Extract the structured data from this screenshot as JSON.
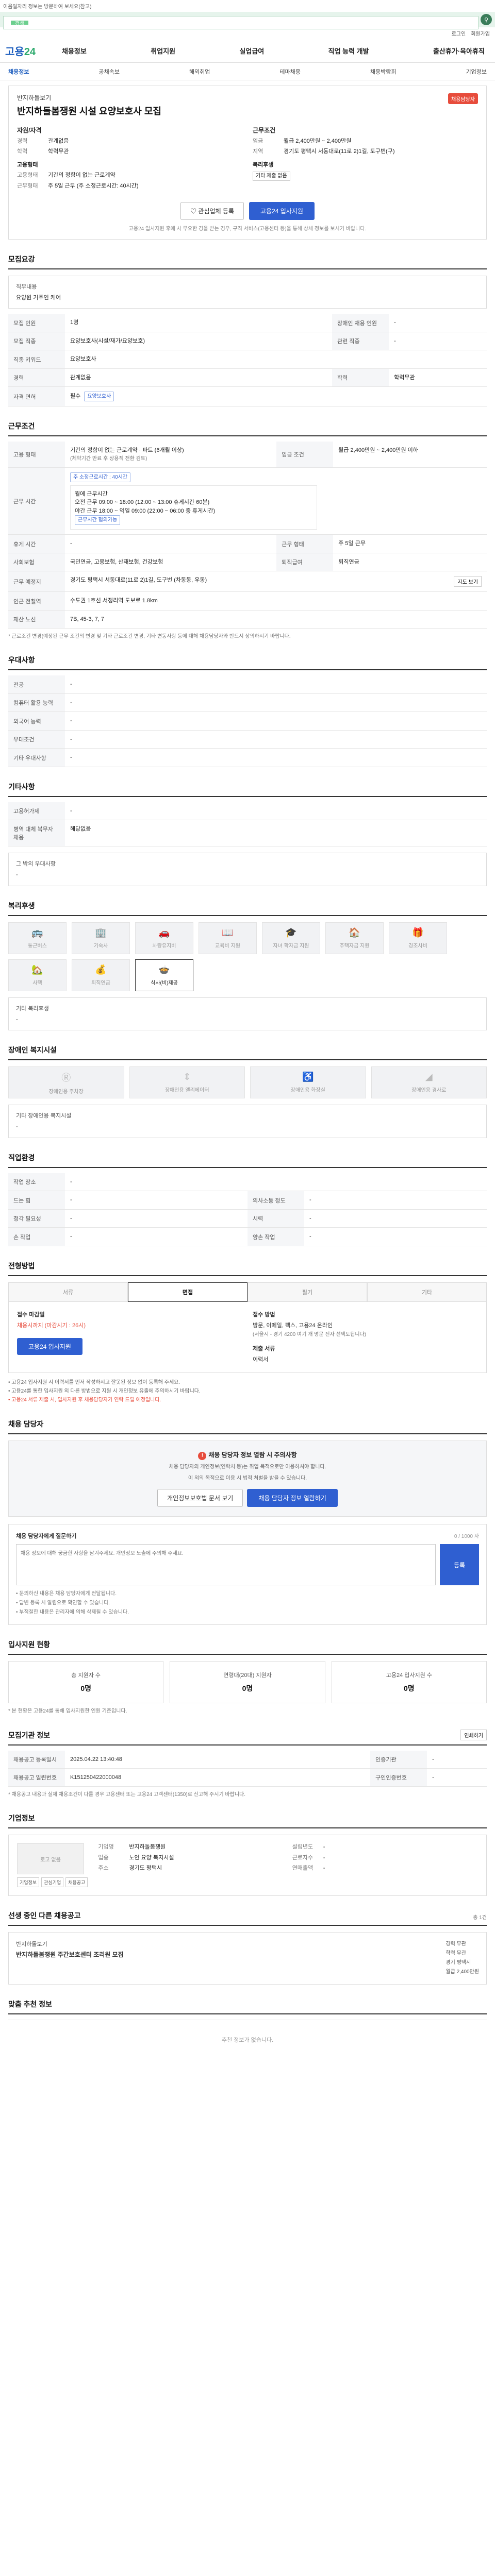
{
  "top_notice": "이음일자리 정보는 방문하여 보세요(참고)",
  "search": {
    "label": "검색",
    "placeholder": ""
  },
  "util_links": [
    "로그인",
    "회원가입"
  ],
  "logo": {
    "main": "고용",
    "accent": "24"
  },
  "gnb": [
    "채용정보",
    "취업지원",
    "실업급여",
    "직업 능력 개발",
    "출산휴가·육아휴직"
  ],
  "subnav": [
    {
      "label": "채용정보",
      "active": true
    },
    {
      "label": "공채속보",
      "active": false
    },
    {
      "label": "해외취업",
      "active": false
    },
    {
      "label": "테마채용",
      "active": false
    },
    {
      "label": "채용박람회",
      "active": false
    },
    {
      "label": "기업정보",
      "active": false
    }
  ],
  "job": {
    "company": "반지하돌보기",
    "title": "반지하돌봄쟁원 시설 요양보호사 모집",
    "badge": "채용담당자",
    "left_title": "자원/자격",
    "left": [
      {
        "k": "경력",
        "v": "관계없음"
      },
      {
        "k": "학력",
        "v": "학력무관"
      },
      {
        "k": "고용형태",
        "v": ""
      },
      {
        "k": "고용형태",
        "v": "기간의 정함이 없는 근로계약"
      },
      {
        "k": "근무형태",
        "v": "주 5일 근무 (주 소정근로시간: 40시간)"
      }
    ],
    "right_title": "근무조건",
    "right": [
      {
        "k": "임금",
        "v": "월급 2,400만원 ~ 2,400만원"
      },
      {
        "k": "지역",
        "v": "경기도 평택시 서동대로(11로 2)1길, 도구번(구)"
      },
      {
        "k": "복리후생",
        "v": ""
      },
      {
        "k": "",
        "v": "기타 제출 없음"
      }
    ],
    "btn_interest": "관심업체 등록",
    "btn_apply": "고용24 입사지원",
    "notice": "고용24 입사지원 후에 사 무요한 경을 받는 경우, 구직 서비스(고용센터 등)을 통해 상세 정보를 보시기 바랍니다."
  },
  "recruit_summary": {
    "title": "모집요강",
    "duty_label": "직무내용",
    "duty": "요양원 거주인 케어",
    "rows": [
      {
        "k": "모집 인원",
        "v": "1명",
        "k2": "장애인 채용 인원",
        "v2": "-"
      },
      {
        "k": "모집 직종",
        "v": "요양보호사(시설/재가/요양보호)",
        "k2": "관련 직종",
        "v2": "-"
      },
      {
        "k": "직종 키워드",
        "v": "요양보호사",
        "k2": "",
        "v2": ""
      },
      {
        "k": "경력",
        "v": "관계없음",
        "k2": "학력",
        "v2": "학력무관"
      },
      {
        "k": "자격 면허",
        "v": "필수",
        "k2": "",
        "v2": ""
      }
    ],
    "license": "요양보호사"
  },
  "conditions": {
    "title": "근무조건",
    "employment": "기간의 정함이 없는 근로계약 · 파트 (6개월 이상)",
    "employment_sub": "(체약기간 만료 후 상용직 전환 검토)",
    "wage_label": "임금 조건",
    "wage": "월급 2,400만원 ~ 2,400만원 이하",
    "hours_label": "근무 시간",
    "hours_tag": "주 소정근로시간 : 40시간",
    "hours": [
      "월에 근무시간",
      "오전 근무 09:00 ~ 18:00 (12:00 ~ 13:00 휴게시간 60분)",
      "야간 근무 18:00 ~ 익일 09:00 (22:00 ~ 06:00 중 휴게시간)",
      "근무시간 협의가능"
    ],
    "holiday_label": "휴게 시간",
    "holiday": "-",
    "shift_label": "근무 형태",
    "shift": "주 5일 근무",
    "insurance_label": "사회보험",
    "insurance": "국민연금, 고용보험, 산재보험, 건강보험",
    "retire_label": "퇴직급여",
    "retire": "퇴직연금",
    "place_label": "근무 예정지",
    "place": "경기도 평택시 서동대로(11로 2)1길, 도구번 (차동동, 우동)",
    "map_btn": "지도 보기",
    "station_label": "인근 전철역",
    "station": "수도권 1호선 서정리역 도보로 1.8km",
    "industry_label": "재산 노선",
    "industry": "7B, 45-3, 7, 7",
    "note": "* 근로조건 변경(예정된 근무 조건의 변경 및 기타 근로조건 변경, 기타 변동사항 등에 대해 채용담당자와 반드시 상의하시기 바랍니다."
  },
  "preferred": {
    "title": "우대사항",
    "rows": [
      {
        "k": "전공",
        "v": "-"
      },
      {
        "k": "컴퓨터 활용 능력",
        "v": "-"
      },
      {
        "k": "외국어 능력",
        "v": "-"
      },
      {
        "k": "우대조건",
        "v": "-"
      },
      {
        "k": "기타 우대사항",
        "v": "-"
      }
    ]
  },
  "other": {
    "title": "기타사항",
    "rows": [
      {
        "k": "고용허가제",
        "v": "-"
      },
      {
        "k": "병역 대체 복무자 채용",
        "v": "해당없음"
      }
    ],
    "extra_title": "그 밖의 우대사항",
    "extra": "-"
  },
  "welfare": {
    "title": "복리후생",
    "items": [
      {
        "label": "통근버스",
        "icon": "bus-icon",
        "on": false
      },
      {
        "label": "기숙사",
        "icon": "building-icon",
        "on": false
      },
      {
        "label": "차량유지비",
        "icon": "car-icon",
        "on": false
      },
      {
        "label": "교육비 지원",
        "icon": "book-icon",
        "on": false
      },
      {
        "label": "자녀 학자금 지원",
        "icon": "graduation-icon",
        "on": false
      },
      {
        "label": "주택자금 지원",
        "icon": "house-icon",
        "on": false
      },
      {
        "label": "경조사비",
        "icon": "gift-icon",
        "on": false
      },
      {
        "label": "사택",
        "icon": "home-icon",
        "on": false
      },
      {
        "label": "퇴직연금",
        "icon": "coin-icon",
        "on": false
      },
      {
        "label": "식사(비)제공",
        "icon": "meal-icon",
        "on": true
      }
    ],
    "extra_title": "기타 복리후생",
    "extra": "-"
  },
  "disability": {
    "title": "장애인 복지시설",
    "items": [
      "장애인용 주차장",
      "장애인용 엘리베이터",
      "장애인용 화장실",
      "장애인용 경사로"
    ],
    "extra_title": "기타 장애인용 복지시설",
    "extra": "-"
  },
  "company_info": {
    "title": "직업환경",
    "rows": [
      {
        "k": "작업 장소",
        "v": "-",
        "k2": "",
        "v2": ""
      },
      {
        "k": "드는 힘",
        "v": "-",
        "k2": "의사소통 정도",
        "v2": "-"
      },
      {
        "k": "청각 필요성",
        "v": "-",
        "k2": "시력",
        "v2": "-"
      },
      {
        "k": "손 작업",
        "v": "-",
        "k2": "양손 작업",
        "v2": "-"
      }
    ]
  },
  "process": {
    "title": "전형방법",
    "tabs": [
      "서류",
      "면접",
      "필기",
      "기타"
    ],
    "active": 1,
    "apply_title": "접수 마감일",
    "deadline": "채용시까지 (마감시기 : 26시)",
    "apply_btn": "고용24 입사지원",
    "method_title": "접수 방법",
    "method": [
      "방문, 이메일, 팩스, 고용24 온라인",
      "(서울시 - 경기 4200 여기 개 명문 전자 선택도됩니다)"
    ],
    "docs_title": "제출 서류",
    "docs": "이력서",
    "bullets": [
      "• 고용24 입사지원 시 이력서를 먼저 작성하시고 잘못된 정보 없이 등록해 주세요.",
      "• 고용24를 통한 입사지원 외 다른 방법으로 지원 시 개인정보 유출에 주의하시기 바랍니다.",
      "• 고용24 서류 제출 시, 입사지원 후 채용담당자가 연락 드릴 예정입니다."
    ]
  },
  "contact": {
    "title": "채용 담당자",
    "warn": "채용 담당자 정보 열람 시 주의사항",
    "lines": [
      "채용 담당자의 개인정보(연락처 등)는 취업 목적으로만 이용하셔야 합니다.",
      "이 외의 목적으로 이용 시 법적 처벌을 받을 수 있습니다."
    ],
    "btn1": "개인정보보호법 문서 보기",
    "btn2": "채용 담당자 정보 열람하기"
  },
  "inquiry": {
    "title": "채용 담당자에게 질문하기",
    "count": "0 / 1000 자",
    "placeholder": "채용 정보에 대해 궁금한 사항을 남겨주세요. 개인정보 노출에 주의해 주세요.",
    "submit": "등록",
    "notes": [
      "• 문의하신 내용은 채용 담당자에게 전달됩니다.",
      "• 답변 등록 시 알림으로 확인할 수 있습니다.",
      "• 부적절한 내용은 관리자에 의해 삭제될 수 있습니다."
    ]
  },
  "applicants": {
    "title": "입사지원 현황",
    "items": [
      {
        "label": "총 지원자 수",
        "value": "0명"
      },
      {
        "label": "연령대(20대) 지원자",
        "value": "0명"
      },
      {
        "label": "고용24 입사지원 수",
        "value": "0명"
      }
    ],
    "note": "* 본 현황은 고용24를 통해 입사지원한 인원 기준입니다."
  },
  "org_info": {
    "title": "모집기관 정보",
    "print_btn": "인쇄하기",
    "rows": [
      {
        "k": "채용공고 등록일시",
        "v": "2025.04.22 13:40:48",
        "k2": "인증기관",
        "v2": "-"
      },
      {
        "k": "채용공고 일련번호",
        "v": "K151250422000048",
        "k2": "구인인증번호",
        "v2": "-"
      }
    ],
    "note": "* 채용공고 내용과 실제 채용조건이 다를 경우 고용센터 또는 고용24 고객센터(1350)로 신고해 주시기 바랍니다."
  },
  "corp": {
    "title": "기업정보",
    "logo_text": "로고 없음",
    "mini": [
      "기업정보",
      "관심기업",
      "채용공고"
    ],
    "cols": [
      [
        {
          "k": "기업명",
          "v": "반지하돌봄쟁원"
        },
        {
          "k": "업종",
          "v": "노인 요양 복지시설"
        },
        {
          "k": "주소",
          "v": "경기도 평택시"
        }
      ],
      [
        {
          "k": "설립년도",
          "v": "-"
        },
        {
          "k": "근로자수",
          "v": "-"
        },
        {
          "k": "연매출액",
          "v": "-"
        }
      ]
    ]
  },
  "similar": {
    "title": "선생 중인 다른 채용공고",
    "aside": "총 1건",
    "company": "반지하돌보기",
    "job_title": "반지하돌봄쟁원 주간보호센터 조리원 모집",
    "meta": [
      "경력 무관",
      "학력 무관",
      "경기 평택시",
      "월급 2,400만원"
    ]
  },
  "recommend": {
    "title": "맞춤 추천 정보",
    "empty": "추천 정보가 없습니다."
  }
}
